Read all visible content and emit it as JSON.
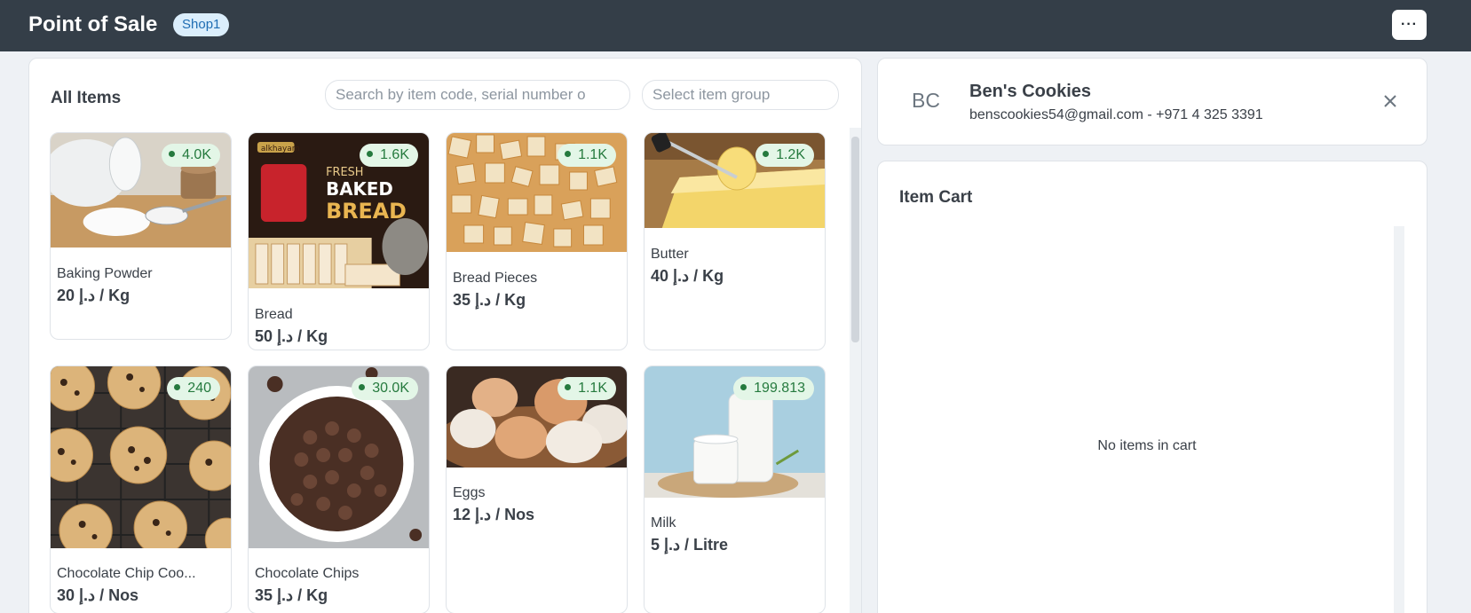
{
  "header": {
    "title": "Point of Sale",
    "shop": "Shop1",
    "menu_label": "···",
    "accent": "#343e48"
  },
  "items_panel": {
    "title": "All Items",
    "search_placeholder": "Search by item code, serial number o",
    "group_placeholder": "Select item group",
    "items": [
      {
        "name": "Baking Powder",
        "price": "20 د.إ / Kg",
        "stock": "4.0K",
        "image": "baking-powder"
      },
      {
        "name": "Bread",
        "price": "50 د.إ / Kg",
        "stock": "1.6K",
        "image": "bread",
        "image_text": {
          "brand": "alkhayam",
          "line1": "FRESH",
          "line2": "BAKED",
          "line3": "BREAD"
        }
      },
      {
        "name": "Bread Pieces",
        "price": "35 د.إ / Kg",
        "stock": "1.1K",
        "image": "bread-pieces"
      },
      {
        "name": "Butter",
        "price": "40 د.إ / Kg",
        "stock": "1.2K",
        "image": "butter"
      },
      {
        "name": "Chocolate Chip Coo...",
        "price": "30 د.إ / Nos",
        "stock": "240",
        "image": "cookies"
      },
      {
        "name": "Chocolate Chips",
        "price": "35 د.إ / Kg",
        "stock": "30.0K",
        "image": "chocolate-chips"
      },
      {
        "name": "Eggs",
        "price": "12 د.إ / Nos",
        "stock": "1.1K",
        "image": "eggs"
      },
      {
        "name": "Milk",
        "price": "5 د.إ / Litre",
        "stock": "199.813",
        "image": "milk"
      }
    ]
  },
  "customer": {
    "initials": "BC",
    "name": "Ben's Cookies",
    "contact": "benscookies54@gmail.com - +971 4 325 3391"
  },
  "cart": {
    "title": "Item Cart",
    "empty_text": "No items in cart"
  },
  "colors": {
    "stock_bg": "#e3f6e7",
    "stock_text": "#257a3e",
    "badge_bg": "#dbeefc",
    "badge_text": "#1f6db3"
  }
}
